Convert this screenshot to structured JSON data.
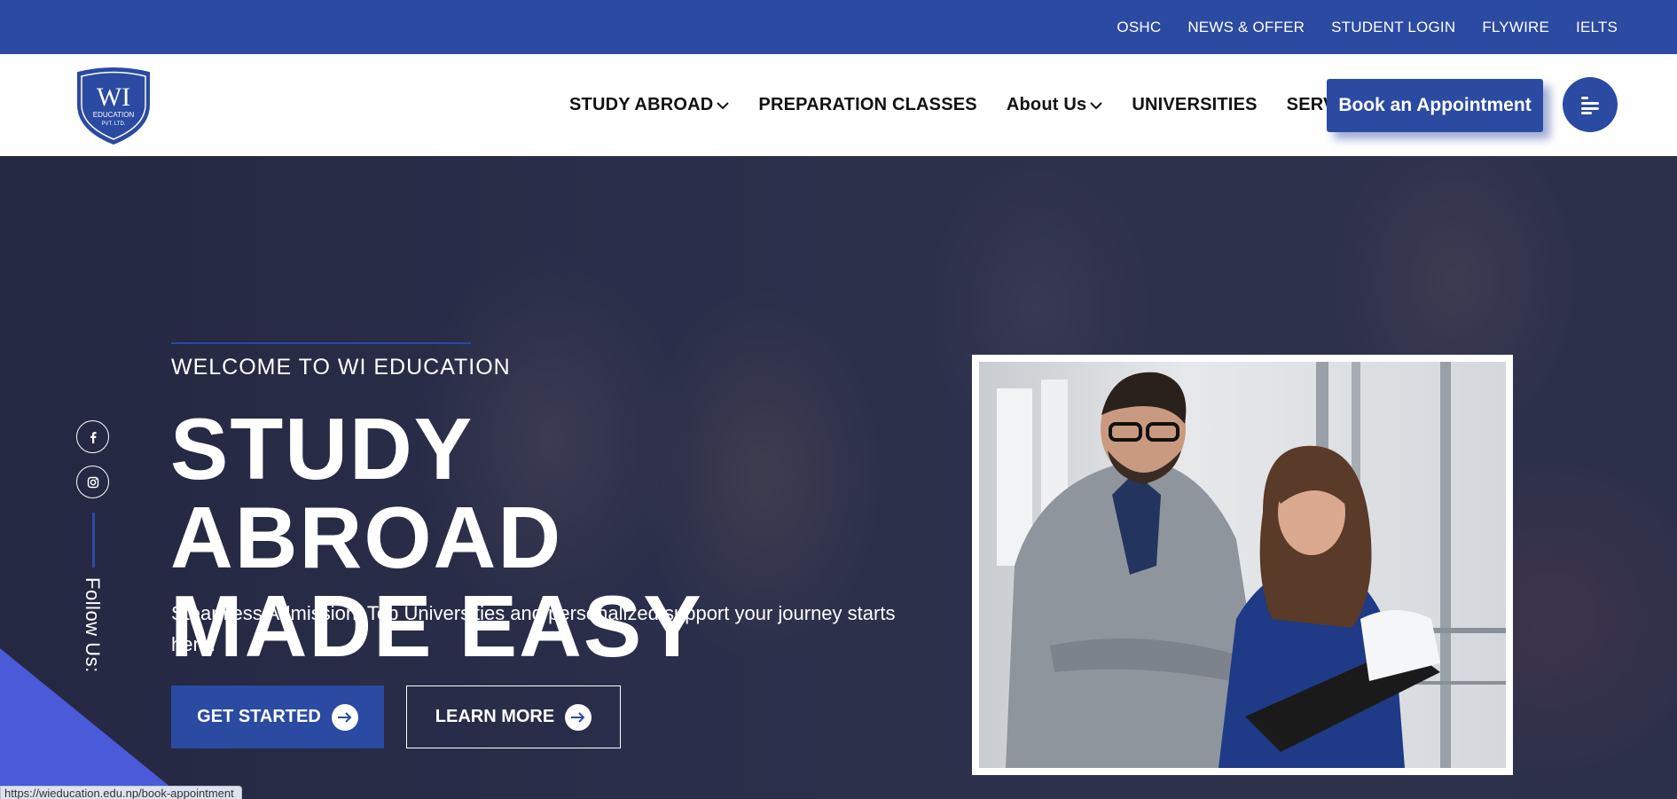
{
  "topbar": {
    "links": [
      "OSHC",
      "NEWS & OFFER",
      "STUDENT LOGIN",
      "FLYWIRE",
      "IELTS"
    ]
  },
  "logo": {
    "text": "WI",
    "sub": "EDUCATION",
    "sub2": "PVT. LTD."
  },
  "nav": {
    "items": [
      {
        "label": "STUDY ABROAD",
        "dropdown": true
      },
      {
        "label": "PREPARATION CLASSES",
        "dropdown": false
      },
      {
        "label": "About Us",
        "dropdown": true
      },
      {
        "label": "UNIVERSITIES",
        "dropdown": false
      },
      {
        "label": "SERVICES",
        "dropdown": false
      }
    ],
    "appointment_label": "Book an Appointment"
  },
  "hero": {
    "welcome": "WELCOME TO WI EDUCATION",
    "title_line1": "STUDY ABROAD",
    "title_line2": "MADE EASY",
    "subtitle": "Steamless Admission, Top Universities and personalized support your journey starts here.",
    "primary_button": "GET STARTED",
    "secondary_button": "LEARN MORE",
    "follow_label": "Follow Us:"
  },
  "status_bar": {
    "url": "https://wieducation.edu.np/book-appointment"
  },
  "colors": {
    "brand": "#2b4aa1",
    "accent_triangle": "#4a5ad8"
  },
  "icons": {
    "social": [
      "facebook-icon",
      "instagram-icon"
    ],
    "menu": "menu-icon",
    "arrow": "arrow-right-icon"
  }
}
